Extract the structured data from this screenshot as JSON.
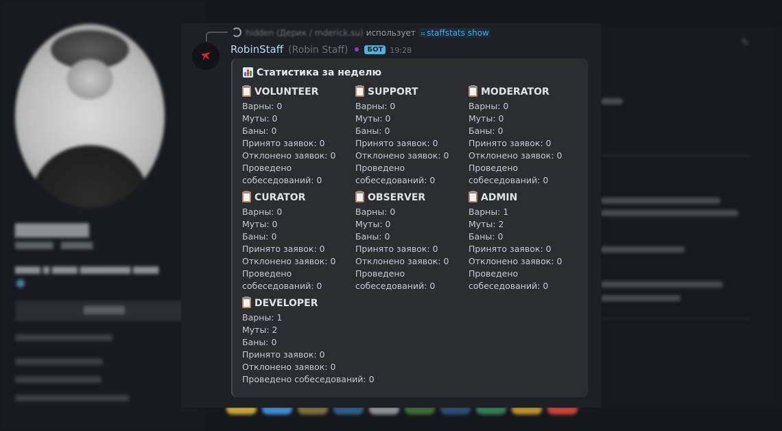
{
  "message": {
    "reply": {
      "username": "hidden",
      "real_name": "(Дерик / mderick.su)",
      "verb": "использует",
      "command": "staffstats show"
    },
    "author": {
      "username": "RobinStaff",
      "display_name": "(Robin Staff)",
      "bot_tag": "БОТ",
      "time": "19:28"
    }
  },
  "embed": {
    "title": "Статистика за неделю",
    "fields": [
      {
        "name": "VOLUNTEER",
        "warns": "Варны: 0",
        "mutes": "Муты: 0",
        "bans": "Баны: 0",
        "accepted": "Принято заявок: 0",
        "rejected": "Отклонено заявок: 0",
        "interviews": "Проведено собеседований: 0"
      },
      {
        "name": "SUPPORT",
        "warns": "Варны: 0",
        "mutes": "Муты: 0",
        "bans": "Баны: 0",
        "accepted": "Принято заявок: 0",
        "rejected": "Отклонено заявок: 0",
        "interviews": "Проведено собеседований: 0"
      },
      {
        "name": "MODERATOR",
        "warns": "Варны: 0",
        "mutes": "Муты: 0",
        "bans": "Баны: 0",
        "accepted": "Принято заявок: 0",
        "rejected": "Отклонено заявок: 0",
        "interviews": "Проведено собеседований: 0"
      },
      {
        "name": "CURATOR",
        "warns": "Варны: 0",
        "mutes": "Муты: 0",
        "bans": "Баны: 0",
        "accepted": "Принято заявок: 0",
        "rejected": "Отклонено заявок: 0",
        "interviews": "Проведено собеседований: 0"
      },
      {
        "name": "OBSERVER",
        "warns": "Варны: 0",
        "mutes": "Муты: 0",
        "bans": "Баны: 0",
        "accepted": "Принято заявок: 0",
        "rejected": "Отклонено заявок: 0",
        "interviews": "Проведено собеседований: 0"
      },
      {
        "name": "ADMIN",
        "warns": "Варны: 1",
        "mutes": "Муты: 2",
        "bans": "Баны: 0",
        "accepted": "Принято заявок: 0",
        "rejected": "Отклонено заявок: 0",
        "interviews": "Проведено собеседований: 0"
      },
      {
        "name": "DEVELOPER",
        "warns": "Варны: 1",
        "mutes": "Муты: 2",
        "bans": "Баны: 0",
        "accepted": "Принято заявок: 0",
        "rejected": "Отклонено заявок: 0",
        "interviews": "Проведено собеседований: 0"
      }
    ]
  },
  "colors": {
    "accent": "#4fb3d9",
    "command": "#43a9e0",
    "username": "#b5dcf5",
    "status_dot": "#8a3bd6",
    "bot_logo": "#d4232f"
  },
  "icons": {
    "title_icon": "bar-chart-icon",
    "field_icon": "clipboard-icon",
    "command_icon": "slash-command-icon",
    "bot_avatar": "robin-logo-icon"
  }
}
